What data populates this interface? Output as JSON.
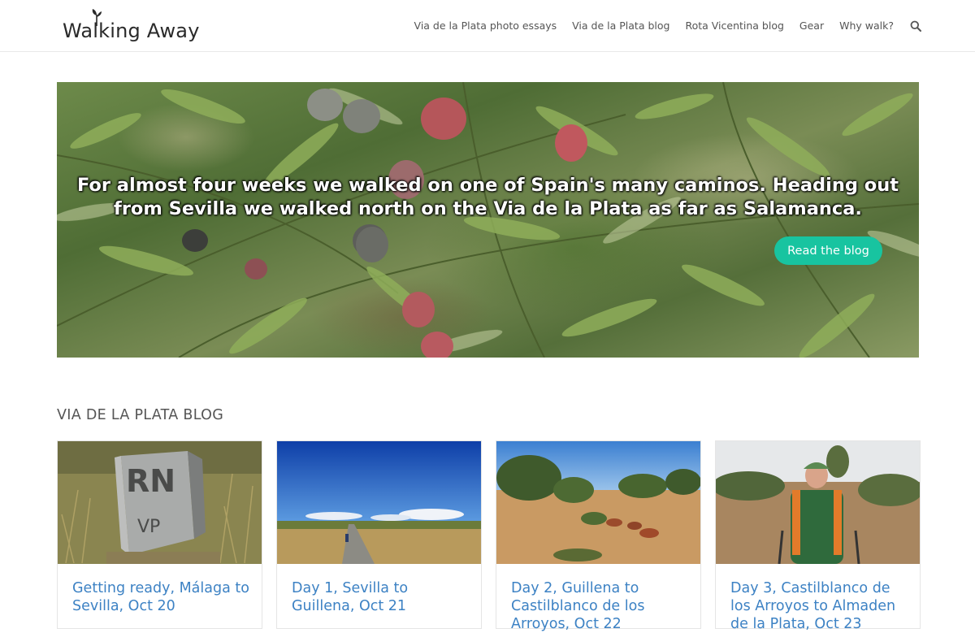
{
  "header": {
    "logo_text": "Walking Away",
    "nav": [
      {
        "label": "Via de la Plata photo essays"
      },
      {
        "label": "Via de la Plata blog"
      },
      {
        "label": "Rota Vicentina blog"
      },
      {
        "label": "Gear"
      },
      {
        "label": "Why walk?"
      }
    ],
    "search_icon": "search-icon"
  },
  "hero": {
    "text": "For almost four weeks we walked on one of Spain's many caminos. Heading out from Sevilla we walked north on the Via de la Plata as far as Salamanca.",
    "button_label": "Read the blog",
    "button_color": "#18c4a0"
  },
  "section": {
    "title": "VIA DE LA PLATA BLOG",
    "cards": [
      {
        "title": "Getting ready, Málaga to Sevilla, Oct 20"
      },
      {
        "title": "Day 1, Sevilla to Guillena, Oct 21"
      },
      {
        "title": "Day 2, Guillena to Castilblanco de los Arroyos, Oct 22"
      },
      {
        "title": "Day 3, Castilblanco de los Arroyos to Almaden de la Plata, Oct 23"
      }
    ]
  },
  "colors": {
    "link": "#3d82c4",
    "accent": "#18c4a0"
  }
}
